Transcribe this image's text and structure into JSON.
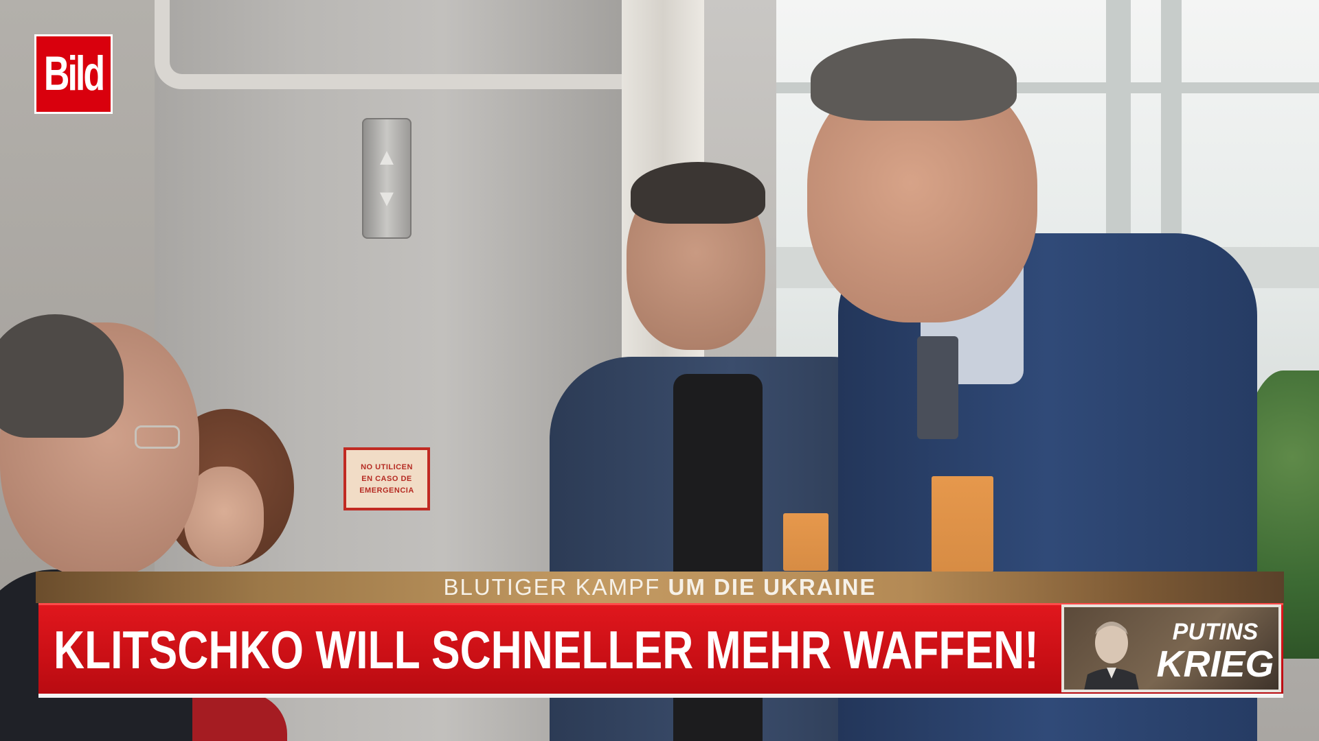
{
  "brand": {
    "logo_text": "Bild",
    "color": "#d9000d"
  },
  "lower_third": {
    "topic_prefix": "BLUTIGER KAMPF",
    "topic_emphasis": "UM DIE UKRAINE",
    "headline": "KLITSCHKO WILL SCHNELLER MEHR WAFFEN!",
    "badge": {
      "line1": "PUTINS",
      "line2": "KRIEG"
    },
    "colors": {
      "headline_red": "#d2141a",
      "topic_gold": "#b48a55"
    }
  },
  "scene": {
    "emergency_sign": "NO UTILICEN\nEN CASO DE\nEMERGENCIA",
    "call_button_icons": [
      "arrow-up-icon",
      "arrow-down-icon"
    ]
  }
}
